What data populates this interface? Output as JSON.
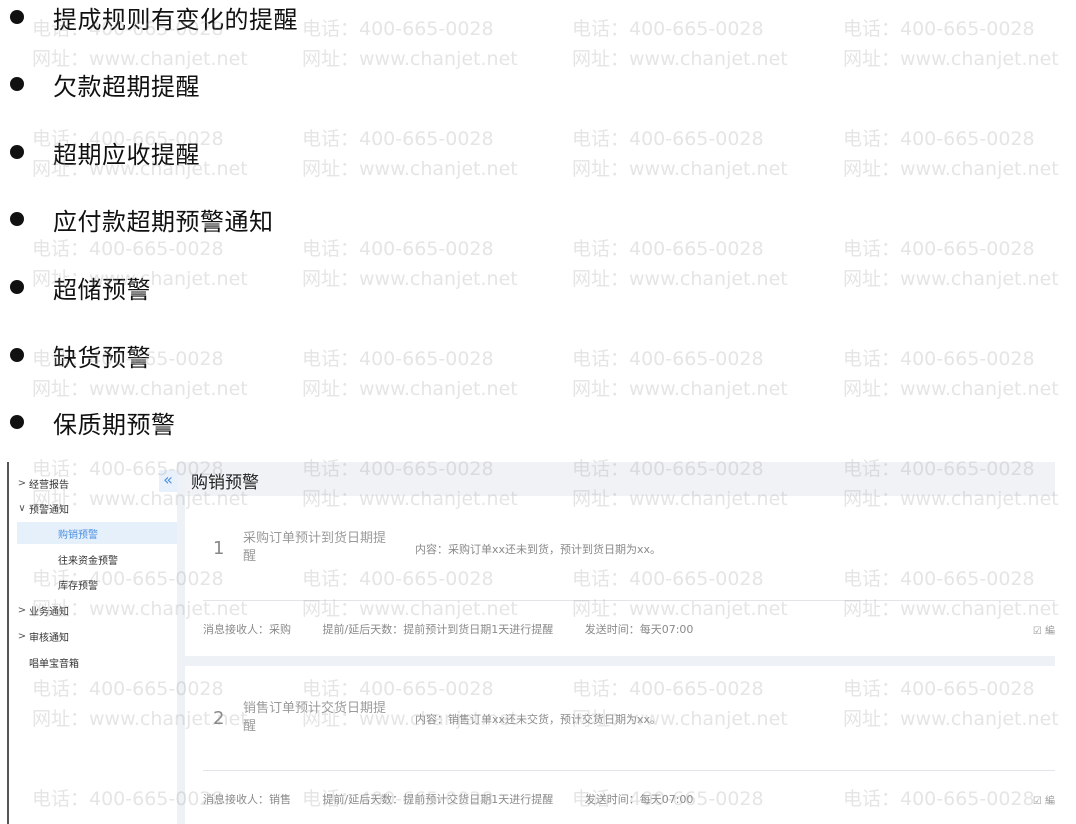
{
  "bullets": [
    "提成规则有变化的提醒",
    "欠款超期提醒",
    "超期应收提醒",
    "应付款超期预警通知",
    "超储预警",
    "缺货预警",
    "保质期预警"
  ],
  "watermark": {
    "phone": "电话：400-665-0028",
    "site": "网址：www.chanjet.net"
  },
  "sidebar": {
    "collapse_icon": "«",
    "items": [
      {
        "label": "经营报告",
        "chevron": ">"
      },
      {
        "label": "预警通知",
        "chevron": "∨"
      },
      {
        "label": "购销预警",
        "sub": true,
        "active": true
      },
      {
        "label": "往来资金预警",
        "sub": true
      },
      {
        "label": "库存预警",
        "sub": true
      },
      {
        "label": "业务通知",
        "chevron": ">"
      },
      {
        "label": "审核通知",
        "chevron": ">"
      },
      {
        "label": "唱单宝音箱",
        "chevron": ""
      }
    ]
  },
  "main": {
    "title": "购销预警",
    "cards": [
      {
        "num": "1",
        "name": "采购订单预计到货日期提醒",
        "content": "内容：采购订单xx还未到货，预计到货日期为xx。",
        "receiver": "消息接收人：采购",
        "days": "提前/延后天数：提前预计到货日期1天进行提醒",
        "time": "发送时间：每天07:00",
        "edit": "☑ 編"
      },
      {
        "num": "2",
        "name": "销售订单预计交货日期提醒",
        "content": "内容：销售订单xx还未交货，预计交货日期为xx。",
        "receiver": "消息接收人：销售",
        "days": "提前/延后天数：提前预计交货日期1天进行提醒",
        "time": "发送时间：每天07:00",
        "edit": "☑ 編"
      }
    ]
  }
}
